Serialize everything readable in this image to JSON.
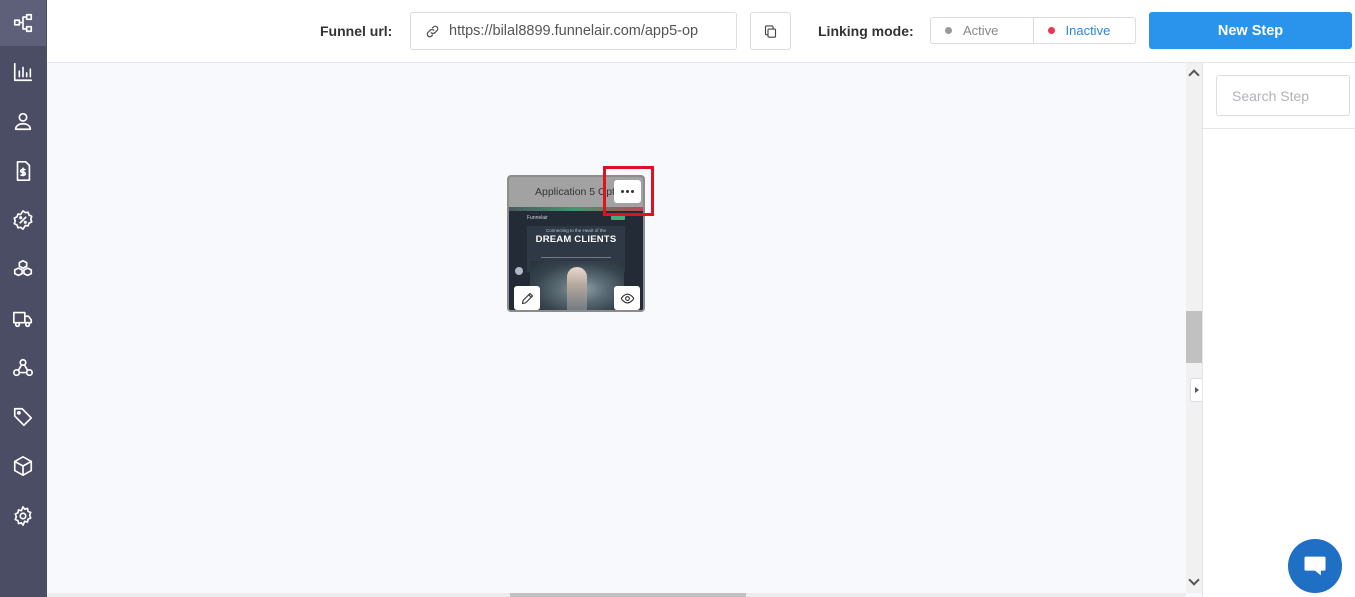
{
  "topbar": {
    "funnel_url_label": "Funnel url:",
    "funnel_url_value": "https://bilal8899.funnelair.com/app5-op",
    "linking_mode_label": "Linking mode:",
    "linking_options": [
      {
        "label": "Active",
        "dot_color": "#9a9a9a"
      },
      {
        "label": "Inactive",
        "dot_color": "#e8384f"
      }
    ],
    "new_step_label": "New Step"
  },
  "right_panel": {
    "search_placeholder": "Search Step"
  },
  "step_card": {
    "title": "Application 5 Opti",
    "thumbnail": {
      "nav_brand": "Funnelair",
      "subheading": "Connecting to the Heart of the",
      "headline": "DREAM CLIENTS"
    }
  },
  "sidebar": {
    "items": [
      {
        "icon": "funnel-flow-icon",
        "active": true
      },
      {
        "icon": "analytics-icon"
      },
      {
        "icon": "contacts-icon"
      },
      {
        "icon": "invoice-icon"
      },
      {
        "icon": "discount-icon"
      },
      {
        "icon": "products-icon"
      },
      {
        "icon": "shipping-icon"
      },
      {
        "icon": "webhook-icon"
      },
      {
        "icon": "tags-icon"
      },
      {
        "icon": "package-icon"
      },
      {
        "icon": "settings-icon"
      }
    ]
  },
  "colors": {
    "sidebar_bg": "#4a4d63",
    "primary": "#2a93ec",
    "highlight": "#e0121f",
    "chat": "#1f6fc5"
  }
}
